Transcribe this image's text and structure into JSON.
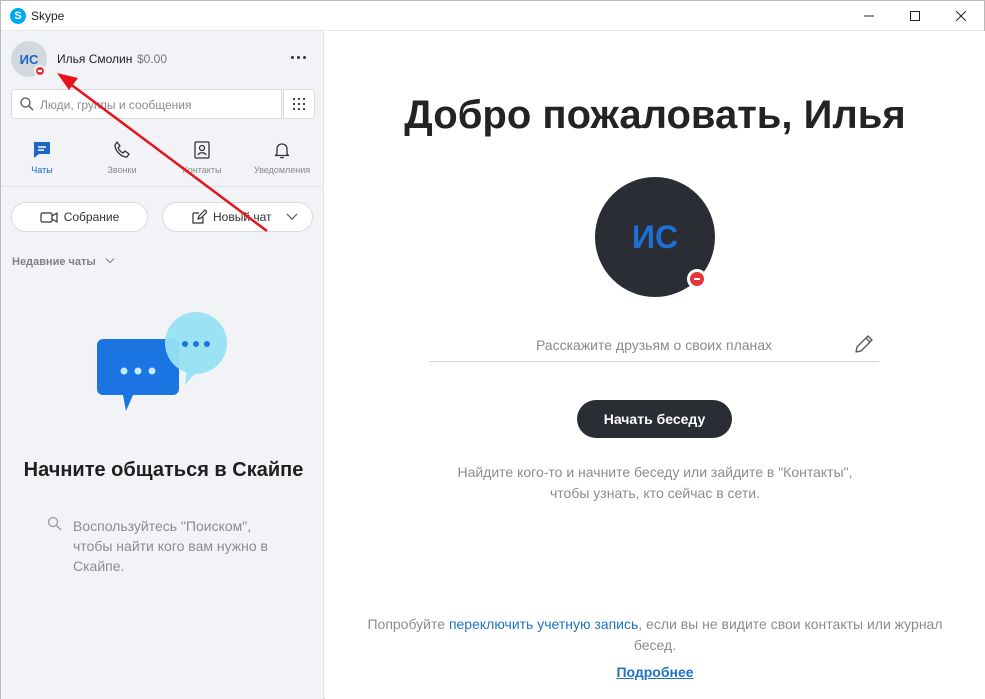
{
  "window": {
    "title": "Skype",
    "logo_letter": "S"
  },
  "profile": {
    "initials": "ИС",
    "name": "Илья Смолин",
    "balance": "$0.00"
  },
  "search": {
    "placeholder": "Люди, группы и сообщения"
  },
  "nav_tabs": [
    {
      "label": "Чаты",
      "icon": "chat-icon",
      "active": true
    },
    {
      "label": "Звонки",
      "icon": "phone-icon",
      "active": false
    },
    {
      "label": "Контакты",
      "icon": "contacts-icon",
      "active": false
    },
    {
      "label": "Уведомления",
      "icon": "bell-icon",
      "active": false
    }
  ],
  "actions": {
    "meeting_label": "Собрание",
    "new_chat_label": "Новый чат"
  },
  "recent": {
    "header": "Недавние чаты"
  },
  "empty_state": {
    "title": "Начните общаться в Скайпе",
    "hint": "Воспользуйтесь \"Поиском\", чтобы найти кого вам нужно в Скайпе."
  },
  "main": {
    "welcome": "Добро пожаловать, Илья",
    "avatar_initials": "ИС",
    "mood_placeholder": "Расскажите друзьям о своих планах",
    "start_button": "Начать беседу",
    "info": "Найдите кого-то и начните беседу или зайдите в \"Контакты\", чтобы узнать, кто сейчас в сети.",
    "switch_prefix": "Попробуйте ",
    "switch_link": "переключить учетную запись",
    "switch_suffix": ", если вы не видите свои контакты или журнал бесед.",
    "learn_more": "Подробнее"
  },
  "colors": {
    "accent": "#1e66c6",
    "status_dnd": "#e8353c",
    "annotation_arrow": "#e8121b",
    "sidebar_bg": "#f1f3f7",
    "button_dark": "#2a2d33"
  }
}
